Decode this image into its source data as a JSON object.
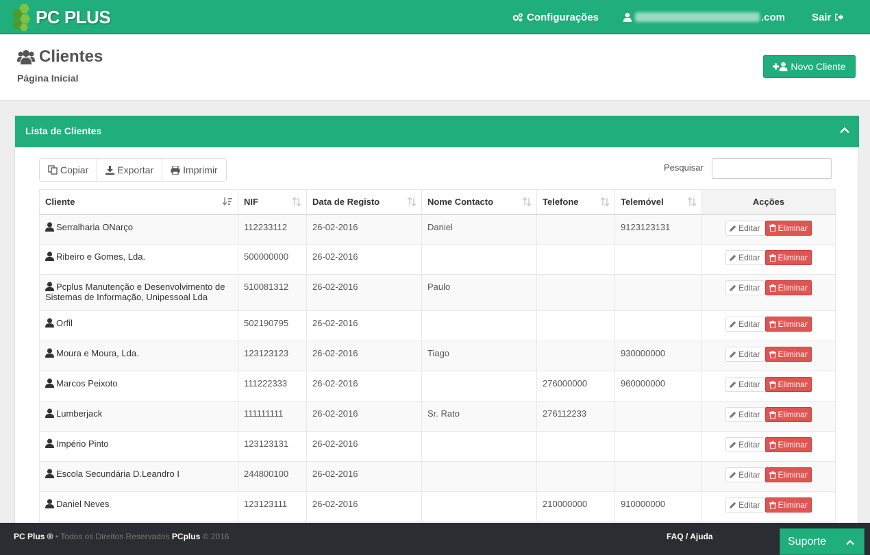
{
  "brand": {
    "name": "PC PLUS"
  },
  "nav": {
    "config_label": "Configurações",
    "user_suffix": ".com",
    "logout_label": "Sair"
  },
  "header": {
    "title": "Clientes",
    "breadcrumb": "Página Inicial",
    "new_button": "Novo Cliente"
  },
  "panel": {
    "title": "Lista de Clientes",
    "tools": {
      "copy": "Copiar",
      "export": "Exportar",
      "print": "Imprimir"
    },
    "search_label": "Pesquisar",
    "search_value": ""
  },
  "table": {
    "columns": [
      "Cliente",
      "NIF",
      "Data de Registo",
      "Nome Contacto",
      "Telefone",
      "Telemóvel",
      "Acções"
    ],
    "edit_label": "Editar",
    "delete_label": "Eliminar",
    "rows": [
      {
        "client": "Serralharia ONarço",
        "nif": "112233112",
        "date": "26-02-2016",
        "contact": "Daniel",
        "phone": "",
        "mobile": "9123123131"
      },
      {
        "client": "Ribeiro e Gomes, Lda.",
        "nif": "500000000",
        "date": "26-02-2016",
        "contact": "",
        "phone": "",
        "mobile": ""
      },
      {
        "client": "Pcplus Manutenção e Desenvolvimento de Sistemas de Informação, Unipessoal Lda",
        "nif": "510081312",
        "date": "26-02-2016",
        "contact": "Paulo",
        "phone": "",
        "mobile": ""
      },
      {
        "client": "Orfil",
        "nif": "502190795",
        "date": "26-02-2016",
        "contact": "",
        "phone": "",
        "mobile": ""
      },
      {
        "client": "Moura e Moura, Lda.",
        "nif": "123123123",
        "date": "26-02-2016",
        "contact": "Tiago",
        "phone": "",
        "mobile": "930000000"
      },
      {
        "client": "Marcos Peixoto",
        "nif": "111222333",
        "date": "26-02-2016",
        "contact": "",
        "phone": "276000000",
        "mobile": "960000000"
      },
      {
        "client": "Lumberjack",
        "nif": "111111111",
        "date": "26-02-2016",
        "contact": "Sr. Rato",
        "phone": "276112233",
        "mobile": ""
      },
      {
        "client": "Império Pinto",
        "nif": "123123131",
        "date": "26-02-2016",
        "contact": "",
        "phone": "",
        "mobile": ""
      },
      {
        "client": "Escola Secundária D.Leandro I",
        "nif": "244800100",
        "date": "26-02-2016",
        "contact": "",
        "phone": "",
        "mobile": ""
      },
      {
        "client": "Daniel Neves",
        "nif": "123123111",
        "date": "26-02-2016",
        "contact": "",
        "phone": "210000000",
        "mobile": "910000000"
      }
    ]
  },
  "footer": {
    "brand": "PC Plus ®",
    "rights": " • Todos os Direitos Reservados ",
    "brand2": "PCplus",
    "year": " © 2016",
    "faq": "FAQ / Ajuda",
    "support": "Suporte"
  },
  "colors": {
    "primary": "#1fae7c",
    "danger": "#e05451",
    "footer_bg": "#2a2d31"
  },
  "icons": [
    "cogs-icon",
    "user-icon",
    "sign-out-icon",
    "users-icon",
    "user-plus-icon",
    "chevron-up-icon",
    "copy-icon",
    "download-icon",
    "print-icon",
    "sort-icon",
    "pencil-icon",
    "trash-icon"
  ]
}
